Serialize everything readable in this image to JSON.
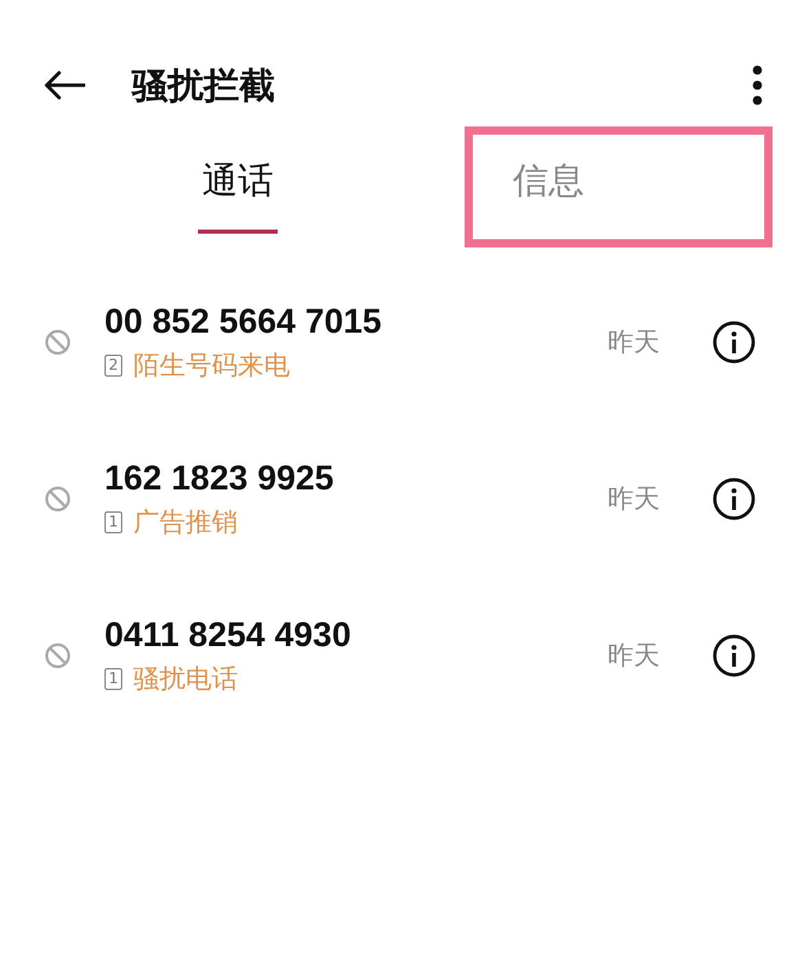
{
  "header": {
    "title": "骚扰拦截"
  },
  "tabs": [
    {
      "label": "通话",
      "selected": true,
      "highlighted": false
    },
    {
      "label": "信息",
      "selected": false,
      "highlighted": true
    }
  ],
  "calls": [
    {
      "number": "00 852 5664 7015",
      "sim": "2",
      "tag": "陌生号码来电",
      "time": "昨天"
    },
    {
      "number": "162 1823 9925",
      "sim": "1",
      "tag": "广告推销",
      "time": "昨天"
    },
    {
      "number": "0411 8254 4930",
      "sim": "1",
      "tag": "骚扰电话",
      "time": "昨天"
    }
  ]
}
